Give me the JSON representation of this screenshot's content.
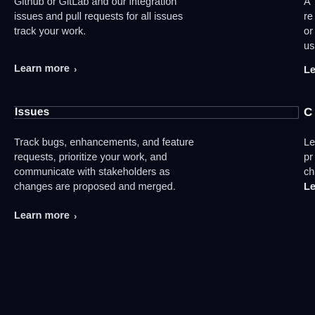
{
  "top_card": {
    "text": "Github or GitLab and our integration\nissues and pull requests for all issues\ntrack your work."
  },
  "top_learn_more": {
    "label": "Learn more",
    "chevron": "›"
  },
  "issues_card": {
    "title": "Issues",
    "text": "Track bugs, enhancements, and feature\nrequests, prioritize your work, and\ncommunicate with stakeholders as\nchanges are proposed and merged."
  },
  "bottom_learn_more": {
    "label": "Learn more",
    "chevron": "›"
  },
  "right_column": {
    "lines": [
      "A",
      "re",
      "or",
      "us"
    ],
    "top_link": "Le",
    "heading": "C",
    "mid_link": "Le",
    "lines2": [
      "pr",
      "ch"
    ],
    "bottom_link": "Le"
  }
}
